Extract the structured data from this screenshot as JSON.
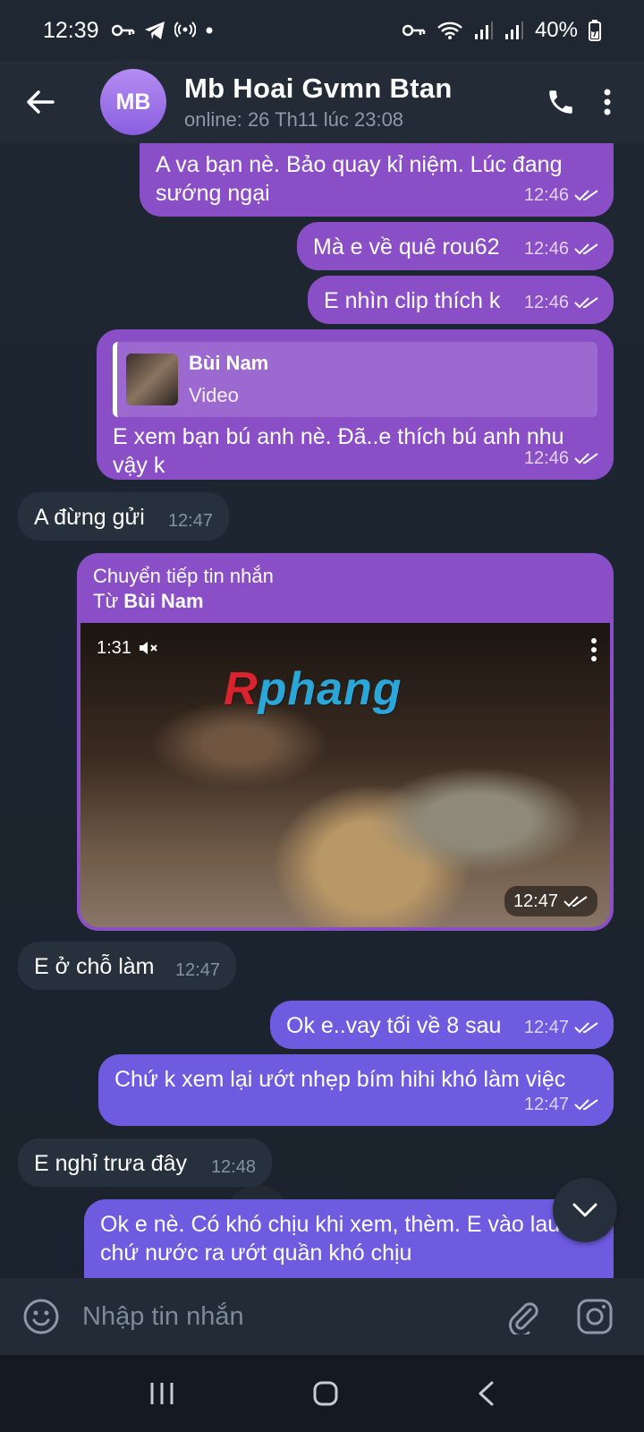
{
  "status_bar": {
    "time": "12:39",
    "battery": "40%"
  },
  "header": {
    "avatar_initials": "MB",
    "contact_name": "Mb Hoai Gvmn Btan",
    "status": "online: 26 Th11 lúc 23:08"
  },
  "messages": [
    {
      "id": "m1",
      "direction": "out",
      "text": "A va bạn nè. Bảo quay kỉ niệm. Lúc đang sướng ngại",
      "time": "12:46"
    },
    {
      "id": "m2",
      "direction": "out",
      "text": "Mà e về quê rou62",
      "time": "12:46"
    },
    {
      "id": "m3",
      "direction": "out",
      "text": "E nhìn clip thích k",
      "time": "12:46"
    },
    {
      "id": "m4",
      "direction": "out",
      "reply_name": "Bùi Nam",
      "reply_type": "Video",
      "text": "E xem bạn bú anh nè. Đã..e thích bú anh nhu vậy k",
      "time": "12:46"
    },
    {
      "id": "m5",
      "direction": "in",
      "text": "A đừng gửi",
      "time": "12:47"
    },
    {
      "id": "m6",
      "direction": "out",
      "forward_label": "Chuyển tiếp tin nhắn",
      "forward_from_prefix": "Từ",
      "forward_from_name": "Bùi Nam",
      "video_duration": "1:31",
      "watermark_r": "R",
      "watermark_rest": "phang",
      "time": "12:47"
    },
    {
      "id": "m7",
      "direction": "in",
      "text": "E ở chỗ làm",
      "time": "12:47"
    },
    {
      "id": "m8",
      "direction": "out",
      "text": "Ok e..vay tối về 8 sau",
      "time": "12:47"
    },
    {
      "id": "m9",
      "direction": "out",
      "text": "Chứ k xem lại ướt nhẹp bím hihi khó làm việc",
      "time": "12:47"
    },
    {
      "id": "m10",
      "direction": "in",
      "text": "E nghỉ trưa đây",
      "time": "12:48"
    },
    {
      "id": "m11",
      "direction": "out",
      "text": "Ok e nè.  Có khó chịu khi xem, thèm. E vào lau đi. chứ nước ra ướt quần khó chịu"
    }
  ],
  "input": {
    "placeholder": "Nhập tin nhắn"
  },
  "colors": {
    "bubble_out": "#8a4fc7",
    "bubble_out_blue": "#6e5be0",
    "bubble_in": "#27313d",
    "header_bg": "#222b36"
  },
  "icons": [
    "back-arrow-icon",
    "phone-icon",
    "more-vert-icon",
    "emoji-icon",
    "attach-icon",
    "camera-icon",
    "double-check-icon",
    "mute-icon",
    "chevron-down-icon"
  ]
}
